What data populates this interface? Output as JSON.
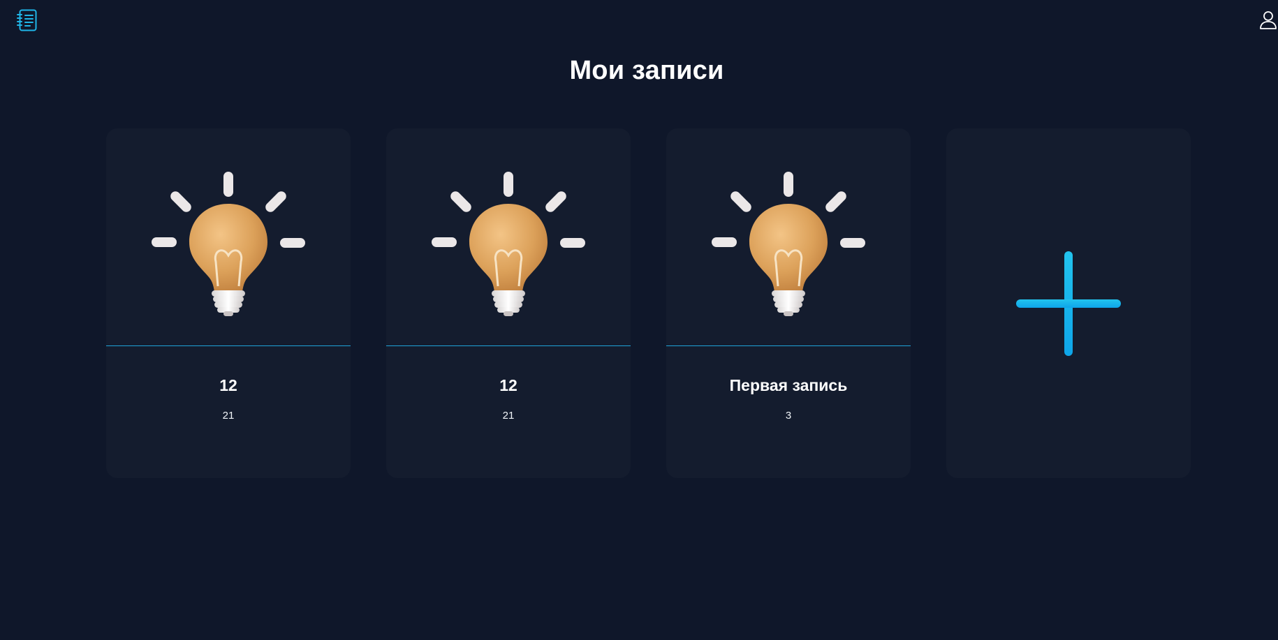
{
  "header": {
    "logo_icon": "notebook-icon",
    "user_icon": "user-icon",
    "accent_color": "#1fb6e8"
  },
  "main": {
    "title": "Мои записи",
    "notes": [
      {
        "title": "12",
        "subtitle": "21",
        "image_icon": "lightbulb-icon"
      },
      {
        "title": "12",
        "subtitle": "21",
        "image_icon": "lightbulb-icon"
      },
      {
        "title": "Первая запись",
        "subtitle": "3",
        "image_icon": "lightbulb-icon"
      }
    ],
    "add_card": {
      "icon": "plus-icon"
    }
  }
}
